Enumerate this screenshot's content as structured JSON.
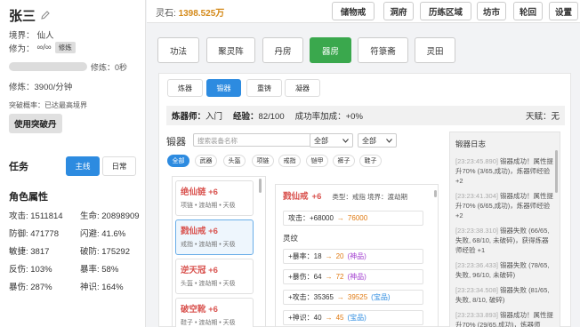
{
  "character": {
    "name": "张三",
    "realm_label": "境界：",
    "realm": "仙人",
    "cultivation_label": "修为：",
    "cultivation": "∞/∞",
    "cultivate_btn": "修炼",
    "progress": 0,
    "progress_label": "修炼：0秒",
    "rate_label": "修炼：",
    "rate": "3900/分钟",
    "breakthrough_text": "突破概率：已达最高境界",
    "breakthrough_btn": "使用突破丹"
  },
  "tasks": {
    "title": "任务",
    "tabs": [
      "主线",
      "日常"
    ]
  },
  "attributes": {
    "title": "角色属性",
    "items": [
      "攻击: 1511814",
      "生命: 20898909",
      "防御: 471778",
      "闪避: 41.6%",
      "敏捷: 3817",
      "破防: 175292",
      "反伤: 103%",
      "暴率: 58%",
      "暴伤: 287%",
      "神识: 164%"
    ]
  },
  "topbar": {
    "spirit_label": "灵石:",
    "spirit_value": "1398.525万",
    "buttons": [
      "储物戒",
      "洞府",
      "历练区域",
      "坊市",
      "轮回",
      "设置"
    ]
  },
  "main_tabs": [
    "功法",
    "聚灵阵",
    "丹房",
    "器房",
    "符箓斋",
    "灵田"
  ],
  "sub_tabs": [
    "炼器",
    "锻器",
    "重铸",
    "凝器"
  ],
  "stats": {
    "master_label": "炼器师：",
    "master": "入门",
    "exp_label": "经验：",
    "exp": "82/100",
    "bonus": "成功率加成：+0%",
    "talent": "天赋：无"
  },
  "equipment": {
    "label": "锻器",
    "search_placeholder": "搜索装备名称",
    "filter1": "全部",
    "filter2": "全部",
    "chips": [
      "全部",
      "武器",
      "头盔",
      "项链",
      "戒指",
      "铠甲",
      "裤子",
      "鞋子"
    ]
  },
  "items": [
    {
      "name": "绝仙链 +6",
      "meta": "项链 • 渡劫期 • 天极"
    },
    {
      "name": "戮仙戒 +6",
      "meta": "戒指 • 渡劫期 • 天极"
    },
    {
      "name": "逆天冠 +6",
      "meta": "头盔 • 渡劫期 • 天极"
    },
    {
      "name": "破空靴 +6",
      "meta": "鞋子 • 渡劫期 • 天极"
    }
  ],
  "detail": {
    "name": "戮仙戒",
    "level": "+6",
    "meta": "类型：戒指 境界：渡劫期",
    "attack_label": "攻击：+68000",
    "attack_to": "76000",
    "section": "灵纹",
    "lines": [
      {
        "label": "+暴率：",
        "from": "18",
        "to": "20",
        "tag": "(神品)",
        "tag_color": "#a33fd0"
      },
      {
        "label": "+暴伤：",
        "from": "64",
        "to": "72",
        "tag": "(神品)",
        "tag_color": "#a33fd0"
      },
      {
        "label": "+攻击：",
        "from": "35365",
        "to": "39525",
        "tag": "(宝品)",
        "tag_color": "#2d8be0"
      },
      {
        "label": "+神识：",
        "from": "40",
        "to": "45",
        "tag": "(宝品)",
        "tag_color": "#2d8be0"
      }
    ]
  },
  "log": {
    "title": "锻器日志",
    "entries": [
      {
        "ts": "[23:23:45.890]",
        "text": "锻器成功！属性提升70% (3/65,成功)，炼器师经验 +2"
      },
      {
        "ts": "[23:23:41.304]",
        "text": "锻器成功！属性提升70% (6/65,成功)，炼器师经验 +2"
      },
      {
        "ts": "[23:23:38.310]",
        "text": "锻器失败 (66/65,失败, 68/10, 未破碎)，获得炼器师经验 +1"
      },
      {
        "ts": "[23:23:36.433]",
        "text": "锻器失败 (78/65,失败, 96/10, 未破碎)"
      },
      {
        "ts": "[23:23:34.508]",
        "text": "锻器失败 (81/65,失败, 8/10, 破碎)"
      },
      {
        "ts": "[23:23:33.893]",
        "text": "锻器成功！属性提升70% (29/65,成功)，炼器师"
      }
    ]
  }
}
